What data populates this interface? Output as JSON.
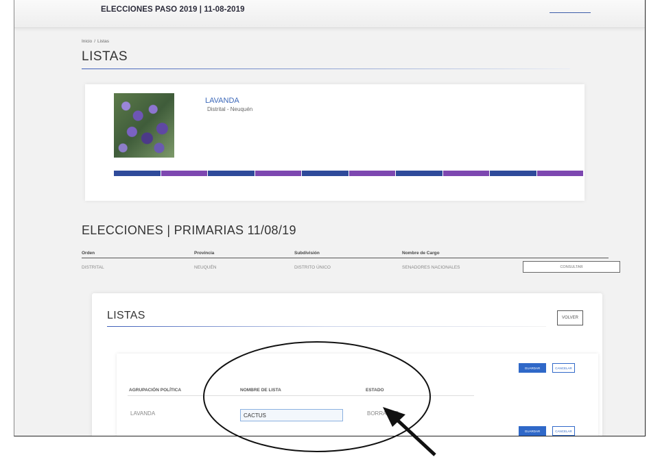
{
  "header": {
    "title": "ELECCIONES PASO 2019 | 11-08-2019"
  },
  "breadcrumb": [
    "Inicio",
    "/",
    "Listas"
  ],
  "page_title": "LISTAS",
  "profile": {
    "name": "LAVANDA",
    "subtitle": "Distrital - Neuquén"
  },
  "color_bar": [
    "#2e4a9a",
    "#7d47b0",
    "#2e4a9a",
    "#7d47b0",
    "#2e4a9a",
    "#7d47b0",
    "#2e4a9a",
    "#7d47b0",
    "#2e4a9a",
    "#7d47b0"
  ],
  "elecciones": {
    "title": "ELECCIONES | PRIMARIAS 11/08/19",
    "headers": [
      "Orden",
      "Provincia",
      "Subdivisión",
      "Nombre de Cargo"
    ],
    "row": [
      "DISTRITAL",
      "NEUQUÉN",
      "DISTRITO ÚNICO",
      "SENADORES NACIONALES"
    ],
    "consultar_label": "CONSULTAR"
  },
  "listas_panel": {
    "title": "LISTAS",
    "volver_label": "VOLVER",
    "guardar_label": "GUARDAR",
    "cancelar_label": "CANCELAR",
    "headers": [
      "AGRUPACIÓN POLÍTICA",
      "NOMBRE DE LISTA",
      "ESTADO"
    ],
    "row": {
      "agrupacion": "LAVANDA",
      "nombre_lista": "CACTUS",
      "estado": "BORRADOR"
    }
  },
  "colors": {
    "accent": "#2f68c8",
    "link": "#3a66b8",
    "annotation": "#111111"
  }
}
